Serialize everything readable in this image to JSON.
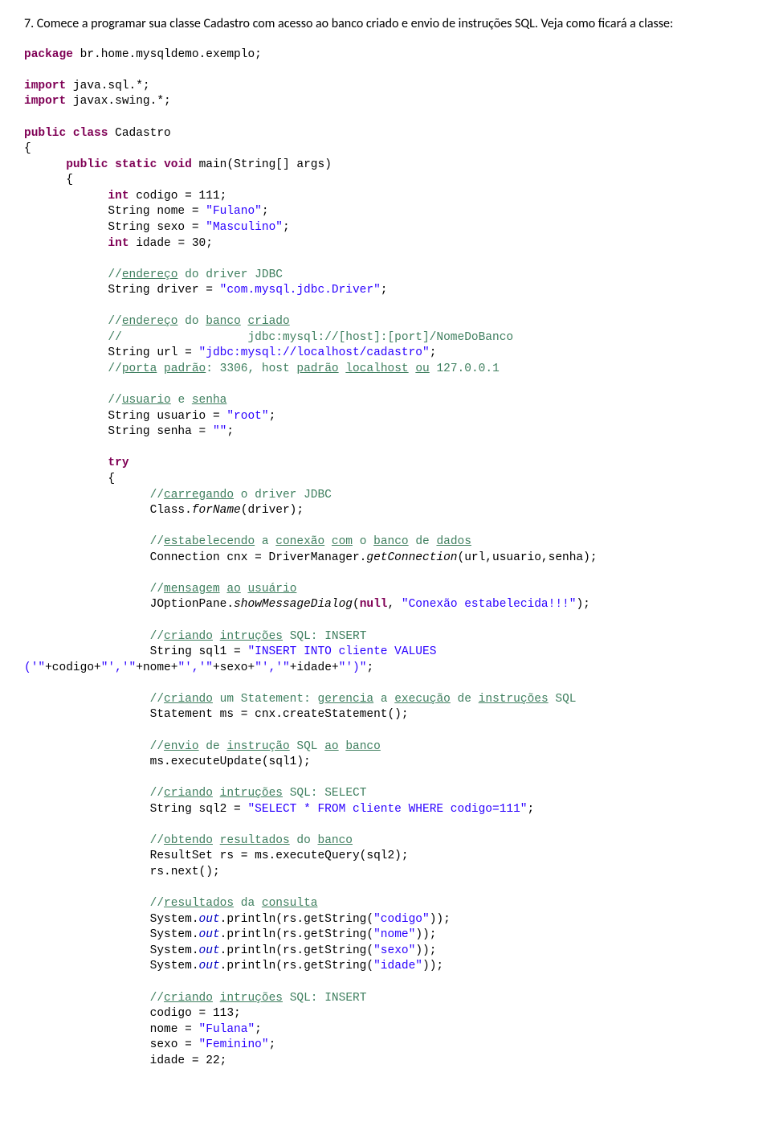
{
  "intro": "7. Comece a programar sua classe Cadastro com acesso ao banco criado e envio de instruções SQL. Veja como ficará a classe:"
}
